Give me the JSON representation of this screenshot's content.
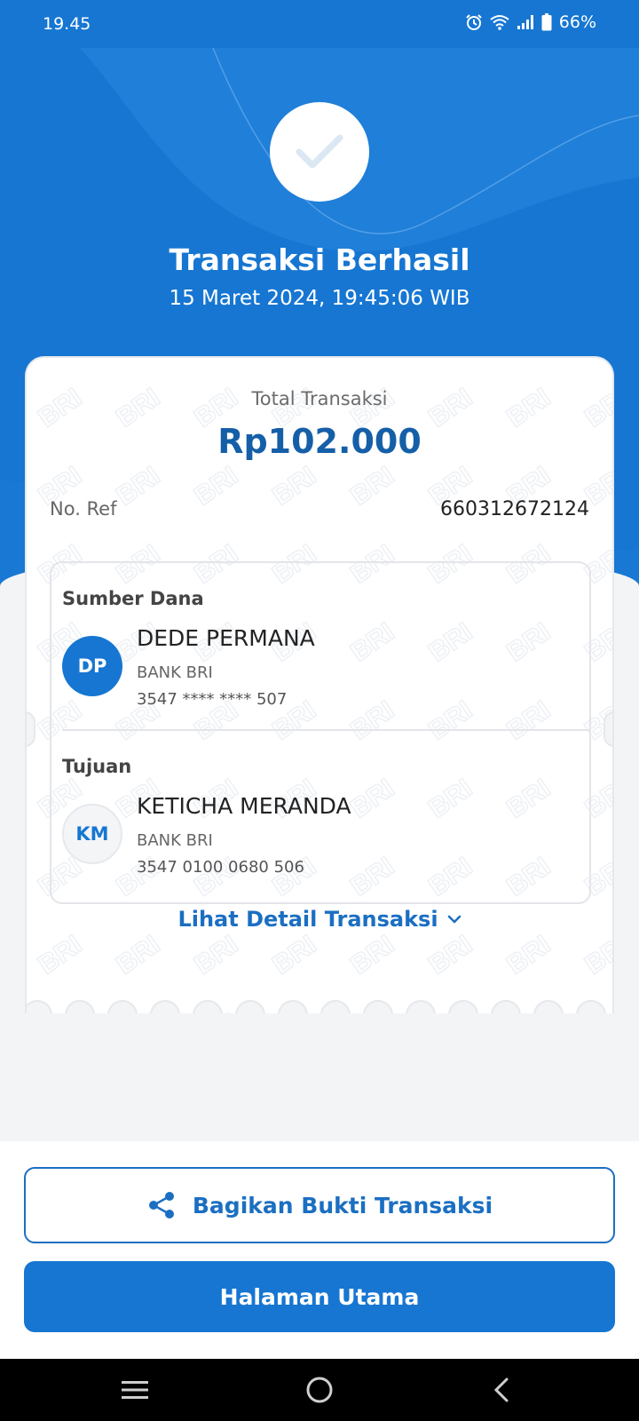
{
  "status_bar": {
    "time": "19.45",
    "battery": "66%",
    "icons": [
      "alarm-icon",
      "wifi-icon",
      "signal-icon",
      "battery-icon"
    ]
  },
  "header": {
    "status_icon": "checkmark-icon",
    "title": "Transaksi Berhasil",
    "datetime": "15 Maret 2024, 19:45:06 WIB"
  },
  "receipt": {
    "watermark_text": "BRI",
    "total_label": "Total Transaksi",
    "total_amount": "Rp102.000",
    "ref_label": "No. Ref",
    "ref_value": "660312672124",
    "source": {
      "section_label": "Sumber Dana",
      "initials": "DP",
      "name": "DEDE PERMANA",
      "bank": "BANK BRI",
      "account": "3547 **** **** 507"
    },
    "destination": {
      "section_label": "Tujuan",
      "initials": "KM",
      "name": "KETICHA MERANDA",
      "bank": "BANK BRI",
      "account": "3547 0100 0680 506"
    },
    "detail_link": "Lihat Detail Transaksi"
  },
  "actions": {
    "share_label": "Bagikan Bukti Transaksi",
    "home_label": "Halaman Utama"
  },
  "nav": {
    "icons": [
      "menu-icon",
      "home-circle-icon",
      "back-icon"
    ]
  },
  "colors": {
    "primary": "#1676d2",
    "amount": "#155fa8",
    "background": "#f3f4f6"
  }
}
